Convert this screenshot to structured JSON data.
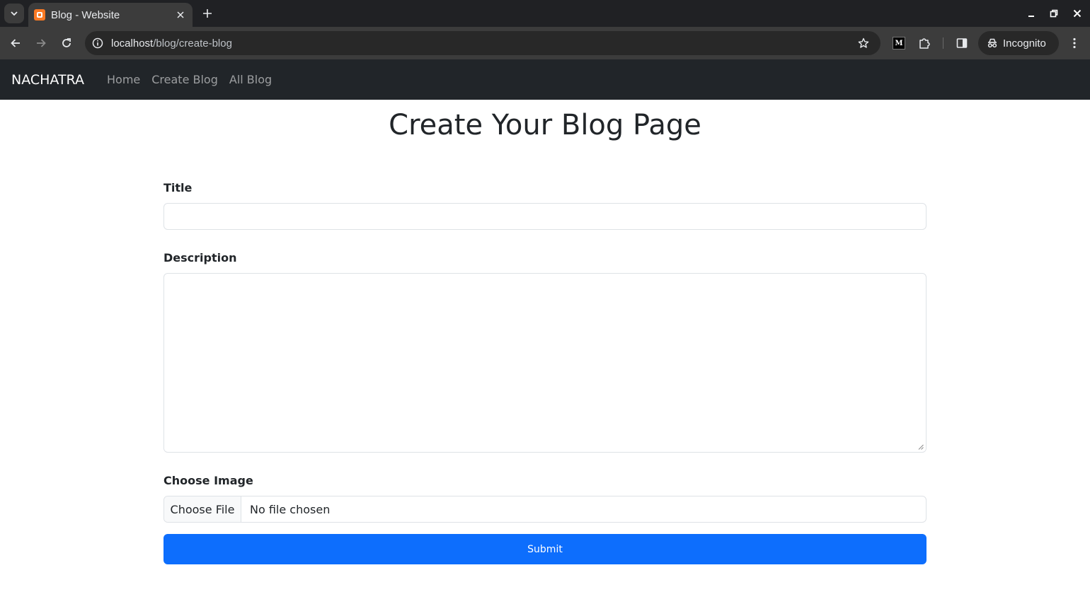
{
  "browser": {
    "tab_title": "Blog - Website",
    "url_host": "localhost",
    "url_path": "/blog/create-blog",
    "profile_label": "Incognito",
    "extension_letter": "M"
  },
  "navbar": {
    "brand": "NACHATRA",
    "links": [
      "Home",
      "Create Blog",
      "All Blog"
    ]
  },
  "page": {
    "title": "Create Your Blog Page"
  },
  "form": {
    "title_label": "Title",
    "title_value": "",
    "description_label": "Description",
    "description_value": "",
    "image_label": "Choose Image",
    "file_button_label": "Choose File",
    "file_status": "No file chosen",
    "submit_label": "Submit"
  },
  "colors": {
    "navbar_bg": "#212529",
    "submit_bg": "#0d6efd",
    "chrome_bg": "#202124",
    "toolbar_bg": "#3c3c3c"
  }
}
